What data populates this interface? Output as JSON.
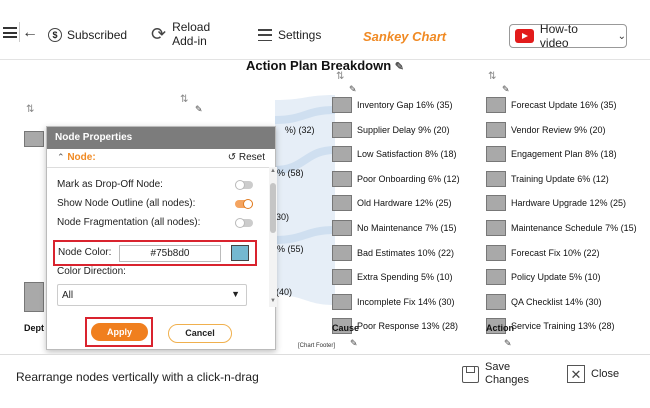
{
  "toolbar": {
    "subscribed_label": "Subscribed",
    "reload_label": "Reload Add-in",
    "settings_label": "Settings",
    "app_title": "Sankey Chart",
    "howto_label": "How-to video"
  },
  "chart": {
    "title": "Action Plan Breakdown",
    "footer": "[Chart Footer]",
    "axis_labels": [
      "Dept",
      "Cause",
      "Action"
    ],
    "partial_labels": [
      "%) (32)",
      "% (58)",
      "30)",
      "3% (55)",
      "(40)"
    ]
  },
  "chart_data": {
    "type": "sankey",
    "title": "Action Plan Breakdown",
    "columns": [
      {
        "name": "Cause",
        "nodes": [
          {
            "label": "Inventory Gap 16% (35)",
            "pct": 16,
            "value": 35
          },
          {
            "label": "Supplier Delay 9% (20)",
            "pct": 9,
            "value": 20
          },
          {
            "label": "Low Satisfaction 8% (18)",
            "pct": 8,
            "value": 18
          },
          {
            "label": "Poor Onboarding 6% (12)",
            "pct": 6,
            "value": 12
          },
          {
            "label": "Old Hardware 12% (25)",
            "pct": 12,
            "value": 25
          },
          {
            "label": "No Maintenance 7% (15)",
            "pct": 7,
            "value": 15
          },
          {
            "label": "Bad Estimates 10% (22)",
            "pct": 10,
            "value": 22
          },
          {
            "label": "Extra Spending 5% (10)",
            "pct": 5,
            "value": 10
          },
          {
            "label": "Incomplete Fix 14% (30)",
            "pct": 14,
            "value": 30
          },
          {
            "label": "Poor Response 13% (28)",
            "pct": 13,
            "value": 28
          }
        ]
      },
      {
        "name": "Action",
        "nodes": [
          {
            "label": "Forecast Update 16% (35)",
            "pct": 16,
            "value": 35
          },
          {
            "label": "Vendor Review 9% (20)",
            "pct": 9,
            "value": 20
          },
          {
            "label": "Engagement Plan 8% (18)",
            "pct": 8,
            "value": 18
          },
          {
            "label": "Training Update 6% (12)",
            "pct": 6,
            "value": 12
          },
          {
            "label": "Hardware Upgrade 12% (25)",
            "pct": 12,
            "value": 25
          },
          {
            "label": "Maintenance Schedule 7% (15)",
            "pct": 7,
            "value": 15
          },
          {
            "label": "Forecast Fix 10% (22)",
            "pct": 10,
            "value": 22
          },
          {
            "label": "Policy Update 5% (10)",
            "pct": 5,
            "value": 10
          },
          {
            "label": "QA Checklist 14% (30)",
            "pct": 14,
            "value": 30
          },
          {
            "label": "Service Training 13% (28)",
            "pct": 13,
            "value": 28
          }
        ]
      }
    ]
  },
  "dialog": {
    "title": "Node Properties",
    "section": "Node:",
    "reset_label": "Reset",
    "drop_off_label": "Mark as Drop-Off Node:",
    "outline_label": "Show Node Outline (all nodes):",
    "fragmentation_label": "Node Fragmentation (all nodes):",
    "color_label": "Node Color:",
    "color_value": "#75b8d0",
    "direction_label": "Color Direction:",
    "direction_value": "All",
    "apply_label": "Apply",
    "cancel_label": "Cancel"
  },
  "bottom": {
    "hint": "Rearrange nodes vertically with a click-n-drag",
    "save_label": "Save Changes",
    "close_label": "Close"
  },
  "colors": {
    "accent": "#f07f1e",
    "highlight": "#d9232e",
    "node": "#a9a9a9",
    "flow": "#dce8f3"
  }
}
